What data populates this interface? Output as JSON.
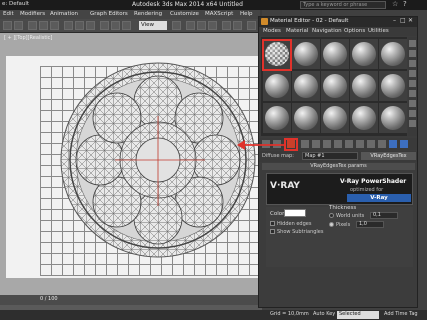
{
  "app": {
    "workspace": "e: Default",
    "title": "Autodesk 3ds Max 2014 x64    Untitled",
    "search_placeholder": "Type a keyword or phrase"
  },
  "menu": [
    "Edit",
    "Modifiers",
    "Animation",
    "Graph Editors",
    "Rendering",
    "Customize",
    "MAXScript",
    "Help"
  ],
  "toolbar": {
    "view": "View"
  },
  "viewport": {
    "label": "[ + ][Top][Realistic]"
  },
  "timeline": {
    "frame": "0 / 100"
  },
  "status": {
    "grid": "Grid = 10,0mm",
    "auto_key": "Auto Key",
    "set_key": "Set Key",
    "selected": "Selected",
    "add_time_tag": "Add Time Tag"
  },
  "material_editor": {
    "title": "Material Editor - 02 - Default",
    "menu": [
      "Modes",
      "Material",
      "Navigation",
      "Options",
      "Utilities"
    ],
    "map_label": "Diffuse map:",
    "map_name": "Map #1",
    "map_type": "VRayEdgesTex",
    "rollout": "VRayEdgesTex params",
    "banner": {
      "logo": "V·RAY",
      "title": "V-Ray PowerShader",
      "subtitle": "optimized for",
      "brand": "V-Ray"
    },
    "params": {
      "color_label": "Color",
      "color_value": "#ffffff",
      "hidden_edges": "Hidden edges",
      "show_subtriangles": "Show Subtriangles",
      "thickness": "Thickness",
      "world_units": "World units",
      "world_units_value": "0,1",
      "pixels": "Pixels",
      "pixels_value": "1,0"
    }
  },
  "colors": {
    "highlight": "#e0322b",
    "vray_brand": "#2a5fae"
  }
}
